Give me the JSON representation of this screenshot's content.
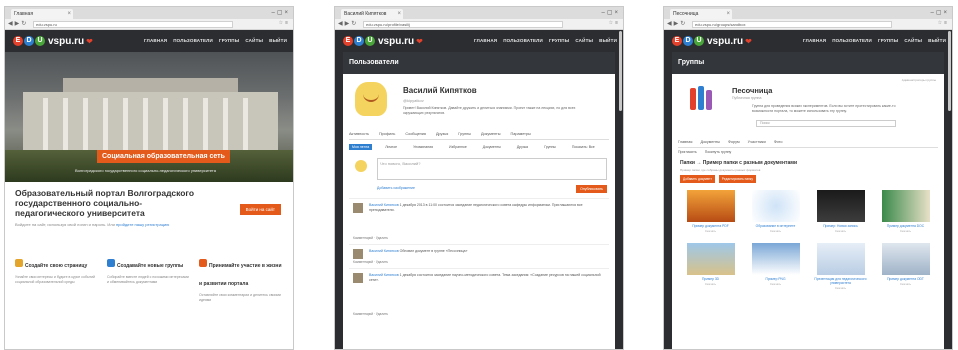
{
  "colors": {
    "accent": "#e35a1a",
    "link": "#2f7fd1",
    "header_bg": "#2b2d31"
  },
  "windows": [
    {
      "tab_title": "Главная",
      "url": "edu.vspu.ru",
      "brand": {
        "letters": [
          "Е",
          "D",
          "U"
        ],
        "site": "vspu.ru"
      },
      "menu": [
        "ГЛАВНАЯ",
        "ПОЛЬЗОВАТЕЛИ",
        "ГРУППЫ",
        "САЙТЫ",
        "ВЫЙТИ"
      ],
      "banner": "Социальная образовательная сеть",
      "banner_sub": "Волгоградского государственного социально-педагогического университета",
      "portal_title": "Образовательный портал Волгоградского государственного социально-педагогического университета",
      "portal_note_prefix": "Войдите на сайт, используя свой логин и пароль. Или",
      "portal_note_link": "пройдите нашу регистрацию",
      "cta": "Войти на сайт",
      "features": [
        {
          "title": "Создайте свою страницу",
          "text": "Узнайте свои интересы и будьте в курсе событий социальной образовательной среды"
        },
        {
          "title": "Создавайте новые группы",
          "text": "Собирайте вместе людей с похожими интересами и обменивайтесь документами"
        },
        {
          "title": "Принимайте участие в жизни и развитии портала",
          "text": "Оставляйте свои комментарии и делитесь своими идеями"
        }
      ]
    },
    {
      "tab_title": "Василий Кипятков",
      "url": "edu.vspu.ru/profile/vasilij",
      "page_title": "Пользователи",
      "user_name": "Василий Кипятков",
      "user_handle": "@kipyatkov",
      "user_bio": "Привет! Василий Кипятков. Давайте дружить и делиться знаниями. Проект также на лекциях, но для всех окружающих результатов.",
      "tabs": [
        "Активность",
        "Профиль",
        "Сообщения",
        "Друзья",
        "Группы",
        "Документы",
        "Параметры"
      ],
      "subtabs": [
        "Моя лента",
        "Личное",
        "Упоминания",
        "Избранное",
        "Документы",
        "Друзья",
        "Группы",
        "Показать: Все"
      ],
      "post_placeholder": "Что нового, Василий?",
      "attach_label": "Добавить изображение",
      "publish_label": "Опубликовать",
      "entries": [
        {
          "author": "Василий Кипятков",
          "text": "1 декабря 2013 в 11:00 состоится заседание педагогического совета кафедры информатики. Приглашаются все преподаватели.",
          "actions": "Комментарий · Удалить"
        },
        {
          "author": "Василий Кипятков",
          "text": "Обновил документ в группе «Песочница»",
          "actions": "Комментарий · Удалить"
        },
        {
          "author": "Василий Кипятков",
          "text": "1 декабря состоится заседание научно-методического совета. Тема заседания: «Создание ресурсов на нашей социальной сети».",
          "actions": "Комментарий · Удалить"
        }
      ]
    },
    {
      "tab_title": "Песочница",
      "url": "edu.vspu.ru/groups/sandbox",
      "page_title": "Группы",
      "group_name": "Песочница",
      "group_sub": "Публичная группа",
      "group_desc": "Группа для проведения всяких экспериментов. Если вы хотите протестировать какие-то возможности портала, то можете использовать эту группу.",
      "search_placeholder": "Поиск",
      "admin_label": "Администраторы группы",
      "tabs": [
        "Главная",
        "Документы",
        "Форум",
        "Участники",
        "Фото"
      ],
      "tabs_b": [
        "Пригласить",
        "Покинуть группу"
      ],
      "folder_title": "Папки → Пример папки с разным документами",
      "folder_note": "Пример папки, где собраны документы разных форматов",
      "folder_buttons": [
        "Добавить документ",
        "Редактировать папку"
      ],
      "docs": [
        {
          "label": "Пример документа PDF",
          "meta": "Скачать"
        },
        {
          "label": "Образование в интернете",
          "meta": "Скачать"
        },
        {
          "label": "Пример: Новая запись",
          "meta": "Скачать"
        },
        {
          "label": "Пример документа DOC",
          "meta": "Скачать"
        },
        {
          "label": "Пример 3D",
          "meta": "Скачать"
        },
        {
          "label": "Пример PNG",
          "meta": "Скачать"
        },
        {
          "label": "Презентация для педагогического университета",
          "meta": "Скачать"
        },
        {
          "label": "Пример документа ODT",
          "meta": "Скачать"
        }
      ]
    }
  ]
}
